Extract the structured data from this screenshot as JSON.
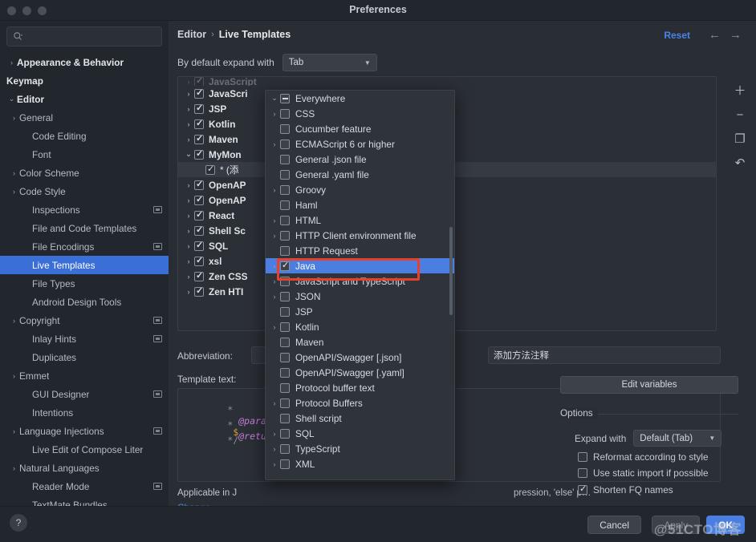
{
  "window": {
    "title": "Preferences"
  },
  "search": {
    "value": "",
    "placeholder": "",
    "icon": "search-icon"
  },
  "sidebar": {
    "items": [
      {
        "label": "Appearance & Behavior",
        "level": 1,
        "arrow": "›",
        "bold": true,
        "badge": false,
        "selected": false
      },
      {
        "label": "Keymap",
        "level": 1,
        "arrow": "",
        "bold": true,
        "badge": false,
        "selected": false
      },
      {
        "label": "Editor",
        "level": 1,
        "arrow": "⌄",
        "bold": true,
        "badge": false,
        "selected": false
      },
      {
        "label": "General",
        "level": 2,
        "arrow": "›",
        "bold": false,
        "badge": false,
        "selected": false
      },
      {
        "label": "Code Editing",
        "level": 2,
        "arrow": "",
        "bold": false,
        "badge": false,
        "selected": false
      },
      {
        "label": "Font",
        "level": 2,
        "arrow": "",
        "bold": false,
        "badge": false,
        "selected": false
      },
      {
        "label": "Color Scheme",
        "level": 2,
        "arrow": "›",
        "bold": false,
        "badge": false,
        "selected": false
      },
      {
        "label": "Code Style",
        "level": 2,
        "arrow": "›",
        "bold": false,
        "badge": false,
        "selected": false
      },
      {
        "label": "Inspections",
        "level": 2,
        "arrow": "",
        "bold": false,
        "badge": true,
        "selected": false
      },
      {
        "label": "File and Code Templates",
        "level": 2,
        "arrow": "",
        "bold": false,
        "badge": false,
        "selected": false
      },
      {
        "label": "File Encodings",
        "level": 2,
        "arrow": "",
        "bold": false,
        "badge": true,
        "selected": false
      },
      {
        "label": "Live Templates",
        "level": 2,
        "arrow": "",
        "bold": false,
        "badge": false,
        "selected": true
      },
      {
        "label": "File Types",
        "level": 2,
        "arrow": "",
        "bold": false,
        "badge": false,
        "selected": false
      },
      {
        "label": "Android Design Tools",
        "level": 2,
        "arrow": "",
        "bold": false,
        "badge": false,
        "selected": false
      },
      {
        "label": "Copyright",
        "level": 2,
        "arrow": "›",
        "bold": false,
        "badge": true,
        "selected": false
      },
      {
        "label": "Inlay Hints",
        "level": 2,
        "arrow": "",
        "bold": false,
        "badge": true,
        "selected": false
      },
      {
        "label": "Duplicates",
        "level": 2,
        "arrow": "",
        "bold": false,
        "badge": false,
        "selected": false
      },
      {
        "label": "Emmet",
        "level": 2,
        "arrow": "›",
        "bold": false,
        "badge": false,
        "selected": false
      },
      {
        "label": "GUI Designer",
        "level": 2,
        "arrow": "",
        "bold": false,
        "badge": true,
        "selected": false
      },
      {
        "label": "Intentions",
        "level": 2,
        "arrow": "",
        "bold": false,
        "badge": false,
        "selected": false
      },
      {
        "label": "Language Injections",
        "level": 2,
        "arrow": "›",
        "bold": false,
        "badge": true,
        "selected": false
      },
      {
        "label": "Live Edit of Compose Liter",
        "level": 2,
        "arrow": "",
        "bold": false,
        "badge": false,
        "selected": false
      },
      {
        "label": "Natural Languages",
        "level": 2,
        "arrow": "›",
        "bold": false,
        "badge": false,
        "selected": false
      },
      {
        "label": "Reader Mode",
        "level": 2,
        "arrow": "",
        "bold": false,
        "badge": true,
        "selected": false
      },
      {
        "label": "TextMate Bundles",
        "level": 2,
        "arrow": "",
        "bold": false,
        "badge": false,
        "selected": false
      }
    ]
  },
  "header": {
    "breadcrumb_root": "Editor",
    "breadcrumb_sep": "›",
    "breadcrumb_current": "Live Templates",
    "reset_label": "Reset",
    "back_icon": "←",
    "forward_icon": "→"
  },
  "expand": {
    "label": "By default expand with",
    "value": "Tab"
  },
  "groups": {
    "rows": [
      {
        "label": "JavaScript",
        "arrow": "›",
        "checked": true,
        "child": false,
        "selected": false,
        "cut": true
      },
      {
        "label": "JavaScri",
        "arrow": "›",
        "checked": true,
        "child": false,
        "selected": false
      },
      {
        "label": "JSP",
        "arrow": "›",
        "checked": true,
        "child": false,
        "selected": false
      },
      {
        "label": "Kotlin",
        "arrow": "›",
        "checked": true,
        "child": false,
        "selected": false
      },
      {
        "label": "Maven",
        "arrow": "›",
        "checked": true,
        "child": false,
        "selected": false
      },
      {
        "label": "MyMon",
        "arrow": "⌄",
        "checked": true,
        "child": false,
        "selected": false
      },
      {
        "label": "* (添",
        "arrow": "",
        "checked": true,
        "child": true,
        "selected": true
      },
      {
        "label": "OpenAP",
        "arrow": "›",
        "checked": true,
        "child": false,
        "selected": false
      },
      {
        "label": "OpenAP",
        "arrow": "›",
        "checked": true,
        "child": false,
        "selected": false
      },
      {
        "label": "React",
        "arrow": "›",
        "checked": true,
        "child": false,
        "selected": false
      },
      {
        "label": "Shell Sc",
        "arrow": "›",
        "checked": true,
        "child": false,
        "selected": false
      },
      {
        "label": "SQL",
        "arrow": "›",
        "checked": true,
        "child": false,
        "selected": false
      },
      {
        "label": "xsl",
        "arrow": "›",
        "checked": true,
        "child": false,
        "selected": false
      },
      {
        "label": "Zen CSS",
        "arrow": "›",
        "checked": true,
        "child": false,
        "selected": false
      },
      {
        "label": "Zen HTI",
        "arrow": "›",
        "checked": true,
        "child": false,
        "selected": false
      }
    ]
  },
  "side_tools": [
    {
      "icon": "plus-icon",
      "glyph": "＋"
    },
    {
      "icon": "minus-icon",
      "glyph": "−"
    },
    {
      "icon": "copy-icon",
      "glyph": "❐"
    },
    {
      "icon": "undo-icon",
      "glyph": "↶"
    }
  ],
  "popup": {
    "title": "context-selection-popup",
    "rows": [
      {
        "label": "Everywhere",
        "arrow": "⌄",
        "state": "tristate",
        "indent": 0,
        "selected": false
      },
      {
        "label": "CSS",
        "arrow": "›",
        "state": "off",
        "indent": 1,
        "selected": false
      },
      {
        "label": "Cucumber feature",
        "arrow": "",
        "state": "off",
        "indent": 1,
        "selected": false
      },
      {
        "label": "ECMAScript 6 or higher",
        "arrow": "›",
        "state": "off",
        "indent": 1,
        "selected": false
      },
      {
        "label": "General .json file",
        "arrow": "",
        "state": "off",
        "indent": 1,
        "selected": false
      },
      {
        "label": "General .yaml file",
        "arrow": "",
        "state": "off",
        "indent": 1,
        "selected": false
      },
      {
        "label": "Groovy",
        "arrow": "›",
        "state": "off",
        "indent": 1,
        "selected": false
      },
      {
        "label": "Haml",
        "arrow": "",
        "state": "off",
        "indent": 1,
        "selected": false
      },
      {
        "label": "HTML",
        "arrow": "›",
        "state": "off",
        "indent": 1,
        "selected": false
      },
      {
        "label": "HTTP Client environment file",
        "arrow": "›",
        "state": "off",
        "indent": 1,
        "selected": false
      },
      {
        "label": "HTTP Request",
        "arrow": "",
        "state": "off",
        "indent": 1,
        "selected": false
      },
      {
        "label": "Java",
        "arrow": "›",
        "state": "on",
        "indent": 1,
        "selected": true
      },
      {
        "label": "JavaScript and TypeScript",
        "arrow": "›",
        "state": "off",
        "indent": 1,
        "selected": false
      },
      {
        "label": "JSON",
        "arrow": "›",
        "state": "off",
        "indent": 1,
        "selected": false
      },
      {
        "label": "JSP",
        "arrow": "",
        "state": "off",
        "indent": 1,
        "selected": false
      },
      {
        "label": "Kotlin",
        "arrow": "›",
        "state": "off",
        "indent": 1,
        "selected": false
      },
      {
        "label": "Maven",
        "arrow": "",
        "state": "off",
        "indent": 1,
        "selected": false
      },
      {
        "label": "OpenAPI/Swagger [.json]",
        "arrow": "",
        "state": "off",
        "indent": 1,
        "selected": false
      },
      {
        "label": "OpenAPI/Swagger [.yaml]",
        "arrow": "",
        "state": "off",
        "indent": 1,
        "selected": false
      },
      {
        "label": "Protocol buffer text",
        "arrow": "",
        "state": "off",
        "indent": 1,
        "selected": false
      },
      {
        "label": "Protocol Buffers",
        "arrow": "›",
        "state": "off",
        "indent": 1,
        "selected": false
      },
      {
        "label": "Shell script",
        "arrow": "",
        "state": "off",
        "indent": 1,
        "selected": false
      },
      {
        "label": "SQL",
        "arrow": "›",
        "state": "off",
        "indent": 1,
        "selected": false
      },
      {
        "label": "TypeScript",
        "arrow": "›",
        "state": "off",
        "indent": 1,
        "selected": false
      },
      {
        "label": "XML",
        "arrow": "›",
        "state": "off",
        "indent": 1,
        "selected": false
      }
    ]
  },
  "detail": {
    "abbreviation_label": "Abbreviation:",
    "abbreviation_value": "",
    "description_label": "Description:",
    "description_value": "添加方法注释",
    "template_text_label": "Template text:",
    "code": {
      "line1_star": "*",
      "line1_tag": "@param",
      "line1_var": "$",
      "line2_star": "*",
      "line2_tag": "@return",
      "line3": "*/"
    },
    "applicable_label": "Applicable in J",
    "applicable_hint": "pression, 'else' p…",
    "change_link": "Change",
    "change_caret": "⌄",
    "edit_variables": "Edit variables"
  },
  "options": {
    "title": "Options",
    "expand_with_label": "Expand with",
    "expand_with_value": "Default (Tab)",
    "checks": [
      {
        "label": "Reformat according to style",
        "checked": false
      },
      {
        "label": "Use static import if possible",
        "checked": false
      },
      {
        "label": "Shorten FQ names",
        "checked": true
      }
    ]
  },
  "footer": {
    "help_icon": "?",
    "cancel": "Cancel",
    "apply": "Apply",
    "ok": "OK"
  },
  "watermark": {
    "text": "@51CTO博客"
  },
  "colors": {
    "accent": "#4a7ee0",
    "selection": "#3a6fd8",
    "annotation": "#e8402a",
    "link": "#4c83e8"
  }
}
